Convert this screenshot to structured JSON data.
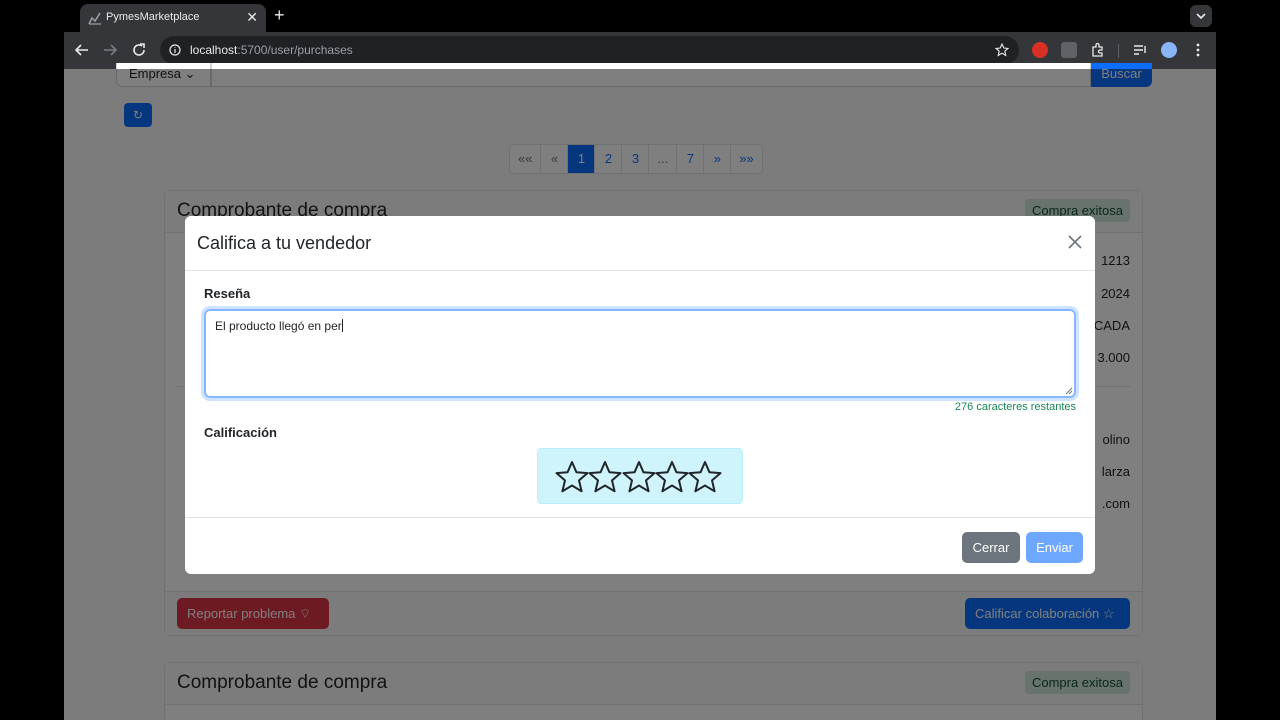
{
  "browser": {
    "tab_title": "PymesMarketplace",
    "url_host": "localhost",
    "url_rest": ":5700/user/purchases"
  },
  "page": {
    "filter_select": "Empresa",
    "search_button": "Buscar",
    "pagination": [
      "«« ",
      "« ",
      "1",
      "2",
      "3",
      "...",
      "7",
      "» ",
      "»» "
    ],
    "cards": [
      {
        "title": "Comprobante de compra",
        "badge": "Compra exitosa",
        "values": [
          "1213",
          "2024",
          "CADA",
          "3.000",
          "olino",
          "larza",
          ".com"
        ],
        "report_button": "Reportar problema",
        "rate_button": "Calificar colaboración"
      },
      {
        "title": "Comprobante de compra",
        "badge": "Compra exitosa"
      }
    ]
  },
  "modal": {
    "title": "Califica a tu vendedor",
    "review_label": "Reseña",
    "review_text": "El producto llegó en per",
    "counter": "276 caracteres restantes",
    "rating_label": "Calificación",
    "rating_value": 0,
    "rating_max": 5,
    "close_button": "Cerrar",
    "submit_button": "Enviar"
  },
  "colors": {
    "primary": "#0d6efd",
    "danger": "#dc3545",
    "success": "#198754",
    "info_bg": "#cff4fc"
  }
}
